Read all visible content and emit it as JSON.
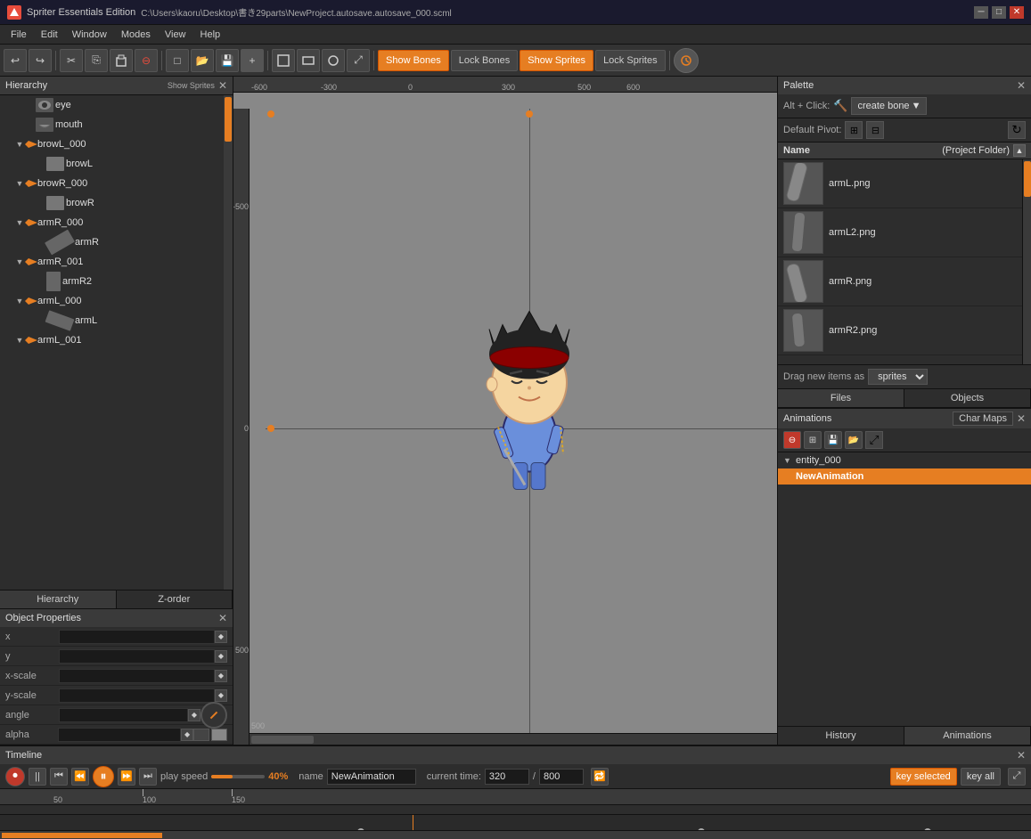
{
  "app": {
    "title": "Spriter Essentials Edition",
    "file_path": "C:\\Users\\kaoru\\Desktop\\書き29parts\\NewProject.autosave.autosave_000.scml"
  },
  "win_controls": {
    "minimize": "─",
    "maximize": "□",
    "close": "✕"
  },
  "menu": {
    "items": [
      "File",
      "Edit",
      "Window",
      "Modes",
      "View",
      "Help"
    ]
  },
  "toolbar": {
    "show_bones": "Show Bones",
    "lock_bones": "Lock Bones",
    "show_sprites": "Show Sprites",
    "lock_sprites": "Lock Sprites"
  },
  "hierarchy": {
    "title": "Hierarchy",
    "show_sprites_label": "Show Sprites",
    "items": [
      {
        "label": "eye",
        "indent": 1,
        "type": "sprite",
        "expanded": false
      },
      {
        "label": "mouth",
        "indent": 1,
        "type": "sprite",
        "expanded": false
      },
      {
        "label": "browL_000",
        "indent": 1,
        "type": "bone",
        "expanded": true
      },
      {
        "label": "browL",
        "indent": 2,
        "type": "sprite",
        "expanded": false
      },
      {
        "label": "browR_000",
        "indent": 1,
        "type": "bone",
        "expanded": true
      },
      {
        "label": "browR",
        "indent": 2,
        "type": "sprite",
        "expanded": false
      },
      {
        "label": "armR_000",
        "indent": 1,
        "type": "bone",
        "expanded": true
      },
      {
        "label": "armR",
        "indent": 2,
        "type": "sprite",
        "expanded": false
      },
      {
        "label": "armR_001",
        "indent": 1,
        "type": "bone",
        "expanded": true
      },
      {
        "label": "armR2",
        "indent": 2,
        "type": "sprite",
        "expanded": false
      },
      {
        "label": "armL_000",
        "indent": 1,
        "type": "bone",
        "expanded": true
      },
      {
        "label": "armL",
        "indent": 2,
        "type": "sprite",
        "expanded": false
      },
      {
        "label": "armL_001",
        "indent": 1,
        "type": "bone",
        "expanded": true
      }
    ],
    "tabs": [
      "Hierarchy",
      "Z-order"
    ]
  },
  "obj_properties": {
    "title": "Object Properties",
    "fields": [
      {
        "label": "x",
        "value": ""
      },
      {
        "label": "y",
        "value": ""
      },
      {
        "label": "x-scale",
        "value": ""
      },
      {
        "label": "y-scale",
        "value": ""
      },
      {
        "label": "angle",
        "value": ""
      },
      {
        "label": "alpha",
        "value": ""
      }
    ]
  },
  "canvas": {
    "ruler_marks": [
      "-500",
      "-300",
      "0",
      "300",
      "500"
    ],
    "ruler_marks_top": [
      "-600",
      "-300",
      "0",
      "300",
      "500",
      "600"
    ],
    "ruler_marks_left": [
      "-500",
      "0",
      "500"
    ]
  },
  "palette": {
    "title": "Palette",
    "create_bone_label": "create bone",
    "alt_click_label": "Alt + Click:",
    "default_pivot_label": "Default Pivot:",
    "col_name": "Name",
    "col_folder": "(Project Folder)",
    "items": [
      {
        "label": "armL.png",
        "bg": "#888"
      },
      {
        "label": "armL2.png",
        "bg": "#888"
      },
      {
        "label": "armR.png",
        "bg": "#888"
      },
      {
        "label": "armR2.png",
        "bg": "#888"
      }
    ],
    "drag_label": "Drag new items as",
    "drag_value": "sprites",
    "tabs": [
      "Files",
      "Objects"
    ]
  },
  "animations": {
    "title": "Animations",
    "char_maps_label": "Char Maps",
    "entity": "entity_000",
    "selected_animation": "NewAnimation",
    "tabs": [
      "History",
      "Animations"
    ]
  },
  "timeline": {
    "title": "Timeline",
    "play_speed_label": "play speed",
    "speed_pct": "40%",
    "name_label": "name",
    "animation_name": "NewAnimation",
    "current_time_label": "current time:",
    "current_time": "320",
    "separator": "/",
    "total_time": "800",
    "key_selected_label": "key selected",
    "key_all_label": "key all",
    "ruler_marks": [
      "50",
      "100",
      "150"
    ],
    "marker_positions": [
      {
        "pct": 35,
        "label": ""
      },
      {
        "pct": 70,
        "label": ""
      },
      {
        "pct": 90,
        "label": ""
      }
    ]
  },
  "icons": {
    "undo": "↩",
    "redo": "↪",
    "cut": "✂",
    "copy": "⎘",
    "paste": "📋",
    "delete": "⊖",
    "new": "□",
    "open": "📂",
    "save": "💾",
    "add": "+",
    "expand": "⤢",
    "bone_symbol": "✦",
    "play_prev_key": "⏮",
    "play_prev": "⏪",
    "play_pause": "⏸",
    "play_next": "⏩",
    "play_next_key": "⏭",
    "record": "⏺",
    "loop": "🔁",
    "close": "✕",
    "collapse": "▼",
    "expand_tree": "▶",
    "refresh": "↻",
    "pivot_copy": "⊞",
    "pivot_paste": "⊟"
  }
}
